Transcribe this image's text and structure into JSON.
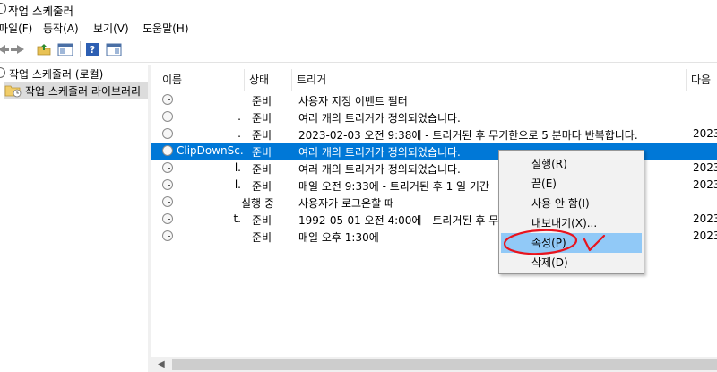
{
  "window": {
    "title": "작업 스케줄러"
  },
  "menubar": [
    "파일(F)",
    "동작(A)",
    "보기(V)",
    "도움말(H)"
  ],
  "toolbar": {
    "icons": [
      "back-arrow-icon",
      "forward-arrow-icon",
      "folder-up-icon",
      "show-hide-console-tree-icon",
      "help-icon",
      "show-hide-action-pane-icon"
    ]
  },
  "tree": {
    "root": "작업 스케줄러 (로컬)",
    "library": "작업 스케줄러 라이브러리"
  },
  "list": {
    "columns": [
      "이름",
      "상태",
      "트리거",
      "다음"
    ],
    "rows": [
      {
        "name": "",
        "status": "준비",
        "trigger": "사용자 지정 이벤트 필터",
        "next": ""
      },
      {
        "name": ".",
        "status": "준비",
        "trigger": "여러 개의 트리거가 정의되었습니다.",
        "next": ""
      },
      {
        "name": ".",
        "status": "준비",
        "trigger": "2023-02-03 오전 9:38에 - 트리거된 후 무기한으로 5 분마다 반복합니다.",
        "next": "2023"
      },
      {
        "name": "ClipDownSc...",
        "status": "준비",
        "trigger": "여러 개의 트리거가 정의되었습니다.",
        "next": ""
      },
      {
        "name": "l.",
        "status": "준비",
        "trigger": "여러 개의 트리거가 정의되었습니다.",
        "next": "2023"
      },
      {
        "name": "l.",
        "status": "준비",
        "trigger": "매일 오전 9:33에 - 트리거된 후 1 일 기간",
        "next": "2023"
      },
      {
        "name": "",
        "status": "실행 중",
        "trigger": "사용자가 로그온할 때",
        "next": ""
      },
      {
        "name": "t.",
        "status": "준비",
        "trigger": "1992-05-01 오전 4:00에 - 트리거된 후 무",
        "next": "2023"
      },
      {
        "name": "",
        "status": "준비",
        "trigger": "매일 오후 1:30에",
        "next": "2023"
      }
    ],
    "selected_index": 3
  },
  "context_menu": {
    "items": [
      "실행(R)",
      "끝(E)",
      "사용 안 함(I)",
      "내보내기(X)...",
      "속성(P)",
      "삭제(D)"
    ],
    "highlighted_index": 4
  },
  "colors": {
    "selection": "#0078d7",
    "menu_highlight": "#91c9f7",
    "annotation": "#e8141e"
  }
}
